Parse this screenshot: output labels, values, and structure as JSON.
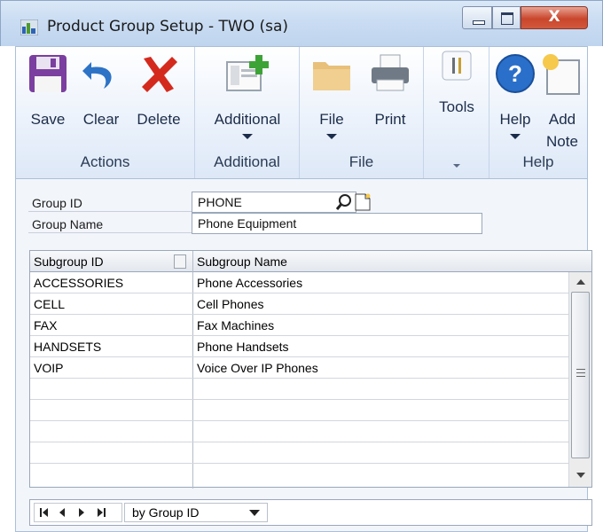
{
  "window": {
    "title": "Product Group Setup  -  TWO (sa)",
    "close_glyph": "X"
  },
  "ribbon": {
    "groups": [
      {
        "label": "Actions",
        "buttons": [
          "Save",
          "Clear",
          "Delete"
        ]
      },
      {
        "label": "Additional",
        "buttons": [
          "Additional"
        ]
      },
      {
        "label": "File",
        "buttons": [
          "File",
          "Print"
        ]
      },
      {
        "label": "",
        "buttons": [
          "Tools"
        ]
      },
      {
        "label": "Help",
        "buttons": [
          "Help",
          "Add",
          "Note"
        ]
      }
    ],
    "save": "Save",
    "clear": "Clear",
    "delete": "Delete",
    "actions_group": "Actions",
    "additional": "Additional",
    "additional_group": "Additional",
    "file": "File",
    "print": "Print",
    "file_group": "File",
    "tools": "Tools",
    "help": "Help",
    "add_note_1": "Add",
    "add_note_2": "Note",
    "help_group": "Help"
  },
  "form": {
    "group_id_label": "Group ID",
    "group_id_value": "PHONE",
    "group_name_label": "Group Name",
    "group_name_value": "Phone Equipment"
  },
  "grid": {
    "columns": [
      "Subgroup ID",
      "Subgroup Name"
    ],
    "rows": [
      [
        "ACCESSORIES",
        "Phone Accessories"
      ],
      [
        "CELL",
        "Cell Phones"
      ],
      [
        "FAX",
        "Fax Machines"
      ],
      [
        "HANDSETS",
        "Phone Handsets"
      ],
      [
        "VOIP",
        "Voice Over IP Phones"
      ],
      [
        "",
        ""
      ],
      [
        "",
        ""
      ],
      [
        "",
        ""
      ],
      [
        "",
        ""
      ],
      [
        "",
        ""
      ]
    ]
  },
  "footer": {
    "sort_value": "by Group ID"
  },
  "colors": {
    "accent": "#c9462c",
    "ribbon_text": "#1b2c4a",
    "help_icon": "#2a6fc9"
  }
}
